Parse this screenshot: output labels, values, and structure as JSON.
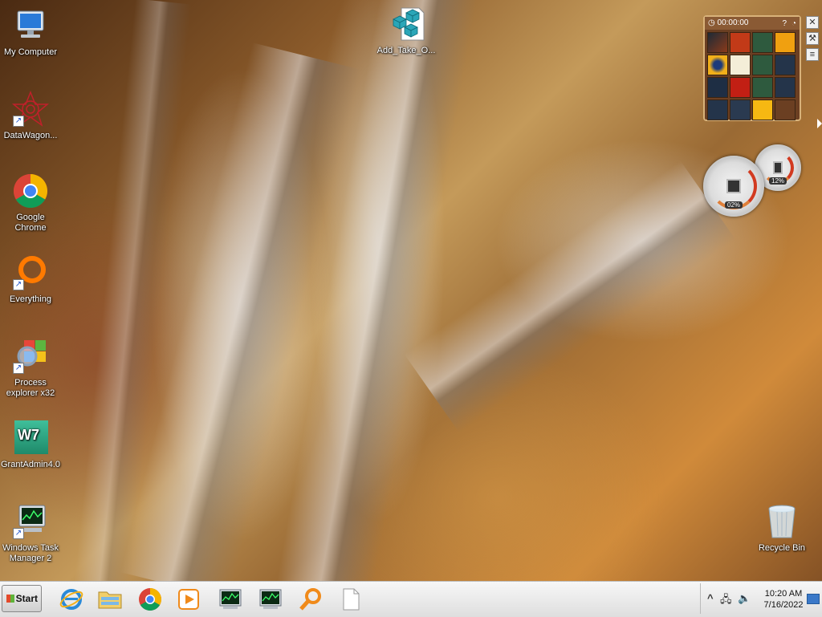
{
  "desktop": {
    "icons": [
      {
        "label": "My Computer",
        "shortcut": false
      },
      {
        "label": "DataWagon...",
        "shortcut": true
      },
      {
        "label": "Google Chrome",
        "shortcut": false
      },
      {
        "label": "Everything",
        "shortcut": true
      },
      {
        "label": "Process explorer x32",
        "shortcut": true
      },
      {
        "label": "GrantAdmin4.0",
        "shortcut": false
      },
      {
        "label": "Windows Task Manager 2",
        "shortcut": true
      },
      {
        "label": "Add_Take_O...",
        "shortcut": false
      },
      {
        "label": "Recycle Bin",
        "shortcut": false
      }
    ],
    "grant_logo_text": "W7"
  },
  "gadgets": {
    "puzzle": {
      "timer": "00:00:00"
    },
    "cpu_meter": {
      "cpu_value": "02%",
      "memory_value": "12%"
    }
  },
  "taskbar": {
    "start_label": "Start",
    "pinned": [
      "internet-explorer",
      "windows-explorer",
      "google-chrome",
      "media-player",
      "task-manager",
      "task-manager-2",
      "everything-search",
      "blank-document"
    ],
    "tray": {
      "show_hidden_label": "^",
      "time": "10:20 AM",
      "date": "7/16/2022"
    }
  },
  "colors": {
    "taskbar_bg": "#e4e4e4",
    "meter_red": "#d23a20",
    "puzzle_frame": "#6b3f22"
  }
}
